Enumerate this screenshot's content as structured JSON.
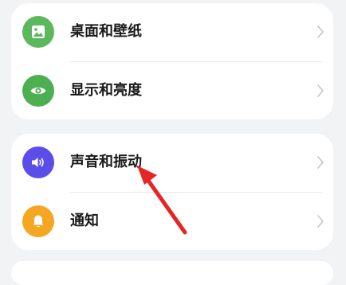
{
  "colors": {
    "background": "#f1f3f5",
    "wallpaper_icon_bg": "#5cb85c",
    "display_icon_bg": "#4caf50",
    "sound_icon_bg": "#5b4de8",
    "notification_icon_bg": "#f5a623",
    "annotation_arrow": "#e62525"
  },
  "group_1": {
    "items": [
      {
        "label": "桌面和壁纸",
        "icon": "image-icon"
      },
      {
        "label": "显示和亮度",
        "icon": "eye-icon"
      }
    ]
  },
  "group_2": {
    "items": [
      {
        "label": "声音和振动",
        "icon": "speaker-icon"
      },
      {
        "label": "通知",
        "icon": "bell-icon"
      }
    ]
  }
}
